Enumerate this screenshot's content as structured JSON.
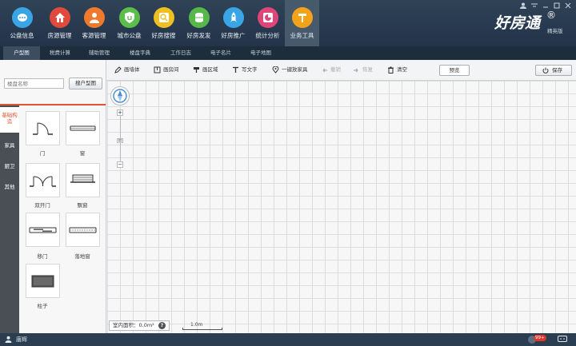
{
  "nav": {
    "items": [
      {
        "label": "公盘信息",
        "icon": "chat-bubble-icon",
        "color": "#3aa5e6"
      },
      {
        "label": "房源管理",
        "icon": "house-icon",
        "color": "#e04a3d"
      },
      {
        "label": "客源管理",
        "icon": "person-icon",
        "color": "#ef7a2e"
      },
      {
        "label": "城市公盘",
        "icon": "shield-icon",
        "color": "#5bbd4a"
      },
      {
        "label": "好房搜搜",
        "icon": "search-icon",
        "color": "#f0c020"
      },
      {
        "label": "好房发发",
        "icon": "database-icon",
        "color": "#55b848"
      },
      {
        "label": "好房推广",
        "icon": "rocket-icon",
        "color": "#3aa5e6"
      },
      {
        "label": "统计分析",
        "icon": "pie-chart-icon",
        "color": "#e0457a"
      },
      {
        "label": "业务工具",
        "icon": "tool-icon",
        "color": "#f2a319"
      }
    ],
    "active_index": 8
  },
  "brand": {
    "name": "好房通",
    "reg": "®",
    "edition": "精英版"
  },
  "subtabs": [
    "户型图",
    "税费计算",
    "辅助管理",
    "楼盘字典",
    "工作日志",
    "电子名片",
    "电子地图"
  ],
  "subtab_active": 0,
  "search": {
    "placeholder": "楼盘名称",
    "button": "搜户型图"
  },
  "categories": [
    "基础构造",
    "家具",
    "厨卫",
    "其他"
  ],
  "category_active": 0,
  "items": [
    "门",
    "窗",
    "双开门",
    "飘窗",
    "移门",
    "落地窗",
    "柱子"
  ],
  "toolbar": {
    "draw_wall": "画墙体",
    "draw_room": "画房间",
    "draw_area": "画区域",
    "write_text": "写文字",
    "place_furniture": "一键放家具",
    "undo": "撤销",
    "redo": "恢复",
    "clear": "清空",
    "preview": "预览",
    "save": "保存"
  },
  "canvas": {
    "zoom_in": "+",
    "zoom_handle": "=",
    "zoom_out": "−",
    "area_label": "室内面积：0.0m²",
    "help": "?",
    "scale": "1.0m"
  },
  "status": {
    "user": "唐辉",
    "badge": "99+"
  }
}
